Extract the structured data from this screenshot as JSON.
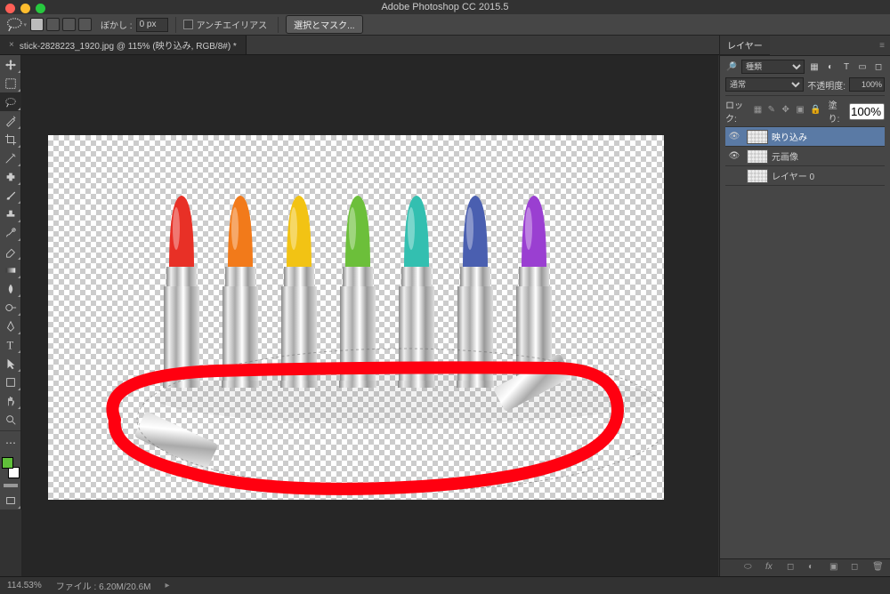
{
  "app_title": "Adobe Photoshop CC 2015.5",
  "options_bar": {
    "feather_label": "ぼかし :",
    "feather_value": "0 px",
    "antialias_label": "アンチエイリアス",
    "mask_button": "選択とマスク..."
  },
  "doc_tab": "stick-2828223_1920.jpg @ 115% (映り込み, RGB/8#) *",
  "layers_panel": {
    "title": "レイヤー",
    "filter_kind": "種類",
    "blend_mode": "通常",
    "opacity_label": "不透明度:",
    "opacity_value": "100%",
    "lock_label": "ロック:",
    "fill_label": "塗り:",
    "fill_value": "100%",
    "layers": [
      {
        "name": "映り込み",
        "visible": true,
        "selected": true
      },
      {
        "name": "元画像",
        "visible": true,
        "selected": false
      },
      {
        "name": "レイヤー 0",
        "visible": false,
        "selected": false
      }
    ]
  },
  "status": {
    "zoom": "114.53%",
    "file_label": "ファイル :",
    "file_value": "6.20M/20.6M"
  },
  "image_content": {
    "description": "Seven silver lipstick tubes with rainbow colored tips on transparent background; red hand-drawn oval annotation around bottom area with two fallen caps",
    "lipstick_colors": [
      "#e83026",
      "#f27a1a",
      "#f2c314",
      "#6cbf3a",
      "#33bfb0",
      "#4a5fb0",
      "#9a3fd1"
    ]
  }
}
